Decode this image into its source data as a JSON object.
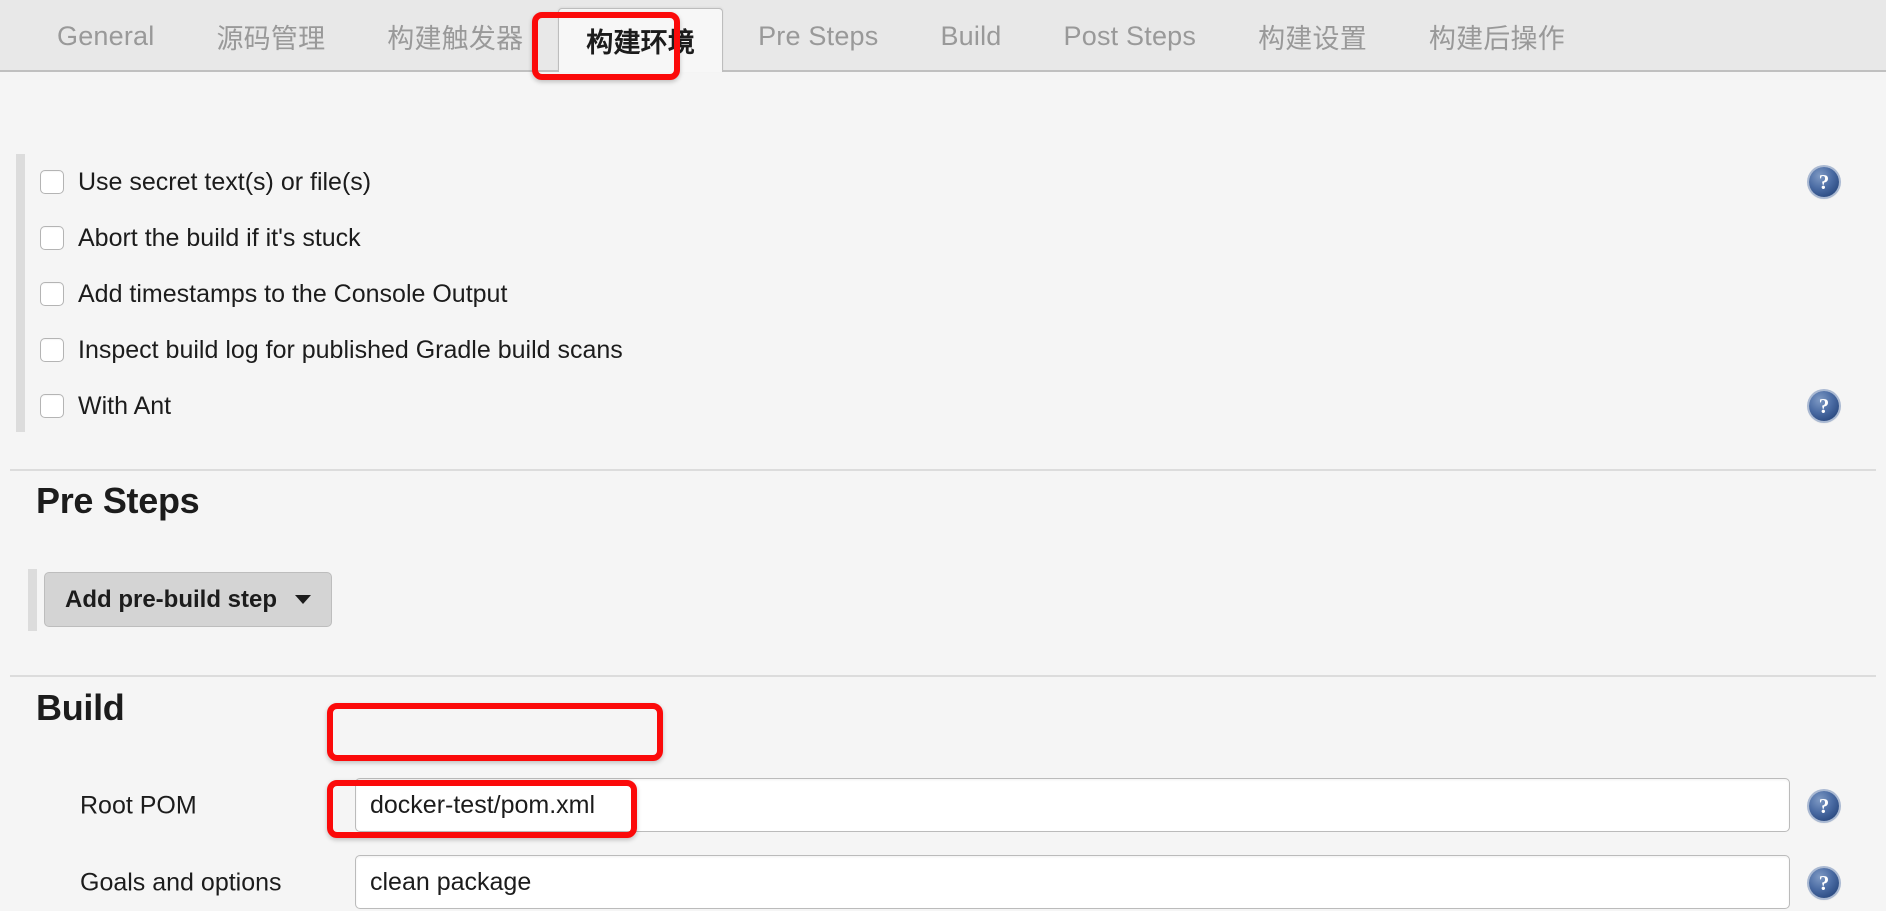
{
  "tabs": [
    {
      "label": "General",
      "active": false
    },
    {
      "label": "源码管理",
      "active": false
    },
    {
      "label": "构建触发器",
      "active": false
    },
    {
      "label": "构建环境",
      "active": true
    },
    {
      "label": "Pre Steps",
      "active": false
    },
    {
      "label": "Build",
      "active": false
    },
    {
      "label": "Post Steps",
      "active": false
    },
    {
      "label": "构建设置",
      "active": false
    },
    {
      "label": "构建后操作",
      "active": false
    }
  ],
  "build_environment": {
    "checkboxes": [
      {
        "label": "Use secret text(s) or file(s)",
        "checked": false,
        "help": true
      },
      {
        "label": "Abort the build if it's stuck",
        "checked": false,
        "help": false
      },
      {
        "label": "Add timestamps to the Console Output",
        "checked": false,
        "help": false
      },
      {
        "label": "Inspect build log for published Gradle build scans",
        "checked": false,
        "help": false
      },
      {
        "label": "With Ant",
        "checked": false,
        "help": true
      }
    ]
  },
  "pre_steps": {
    "title": "Pre Steps",
    "add_button_label": "Add pre-build step"
  },
  "build": {
    "title": "Build",
    "fields": [
      {
        "label": "Root POM",
        "value": "docker-test/pom.xml",
        "placeholder": ""
      },
      {
        "label": "Goals and options",
        "value": "clean package",
        "placeholder": ""
      }
    ]
  },
  "icons": {
    "help": "?",
    "help_icon_name": "help-icon",
    "chevron_down": "▾"
  },
  "annotations": {
    "highlight_color": "#fb0a0a",
    "boxes": [
      {
        "target": "tab-构建环境"
      },
      {
        "target": "root-pom-input"
      },
      {
        "target": "goals-and-options-input"
      }
    ]
  }
}
